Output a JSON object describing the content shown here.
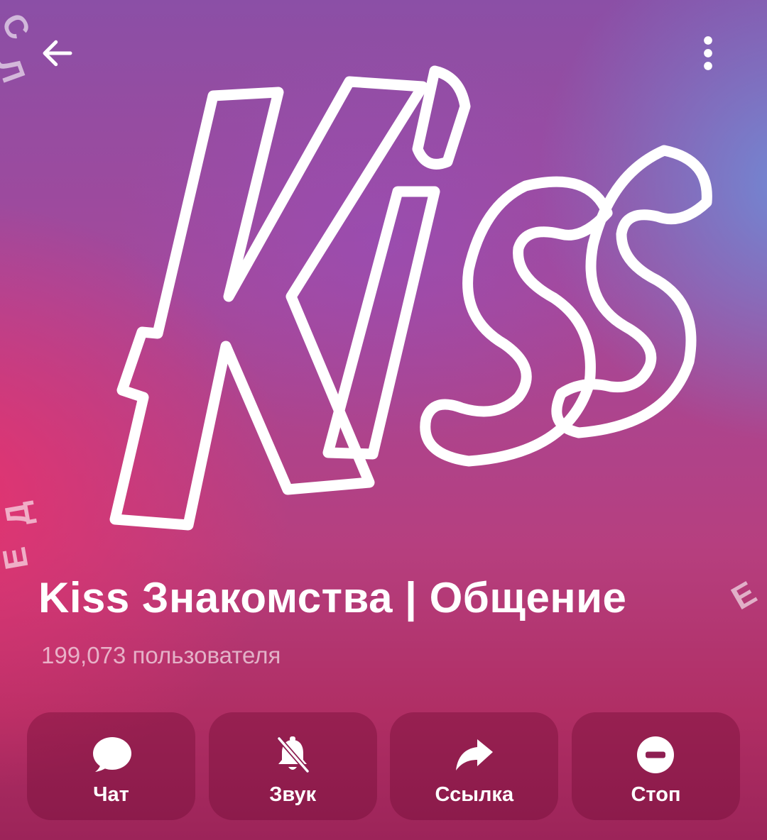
{
  "header": {
    "back_icon": "arrow-left-icon",
    "menu_icon": "more-vert-icon"
  },
  "cover": {
    "logo_text": "Kiss"
  },
  "group": {
    "title": "Kiss Знакомства | Общение",
    "members": "199,073 пользователя"
  },
  "actions": [
    {
      "label": "Чат",
      "icon": "chat-bubble-icon"
    },
    {
      "label": "Звук",
      "icon": "bell-off-icon"
    },
    {
      "label": "Ссылка",
      "icon": "share-arrow-icon"
    },
    {
      "label": "Стоп",
      "icon": "block-icon"
    }
  ],
  "colors": {
    "text": "#ffffff",
    "subtitle": "#f2c4d9",
    "pink": "#e8326e",
    "purple": "#8b4fa6",
    "blue": "#6e8cd7"
  }
}
